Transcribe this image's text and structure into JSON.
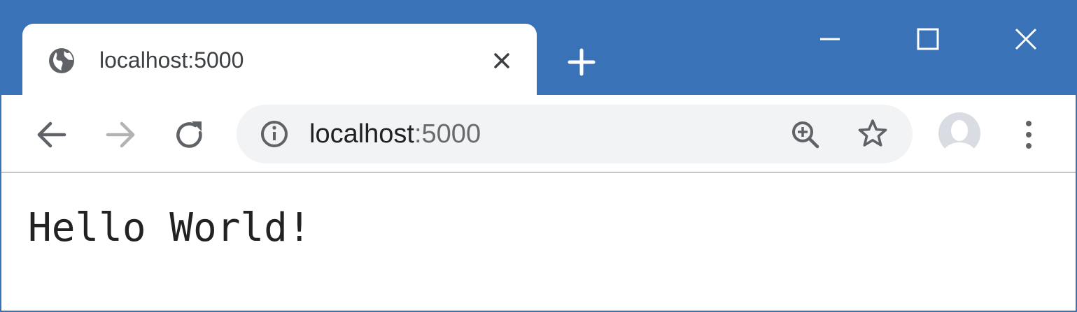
{
  "tab": {
    "title": "localhost:5000",
    "favicon_icon": "globe-icon",
    "close_icon": "close-icon"
  },
  "window_controls": {
    "new_tab_icon": "plus-icon",
    "minimize_icon": "minimize-icon",
    "maximize_icon": "maximize-icon",
    "close_icon": "close-icon"
  },
  "toolbar": {
    "back_icon": "arrow-left-icon",
    "forward_icon": "arrow-right-icon",
    "reload_icon": "reload-icon",
    "omnibox": {
      "info_icon": "info-icon",
      "url_host": "localhost",
      "url_port": ":5000",
      "zoom_icon": "zoom-in-icon",
      "bookmark_icon": "star-icon"
    },
    "profile_icon": "avatar-icon",
    "menu_icon": "more-vertical-icon"
  },
  "page": {
    "body_text": "Hello World!"
  },
  "colors": {
    "titlebar": "#3a72b8",
    "omnibox_bg": "#f1f3f4",
    "text": "#222222"
  }
}
